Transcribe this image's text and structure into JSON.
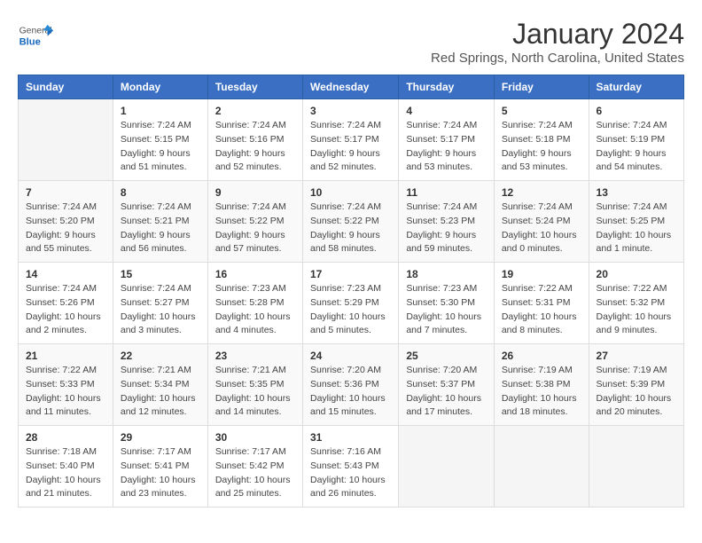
{
  "header": {
    "logo_general": "General",
    "logo_blue": "Blue",
    "main_title": "January 2024",
    "subtitle": "Red Springs, North Carolina, United States"
  },
  "days_of_week": [
    "Sunday",
    "Monday",
    "Tuesday",
    "Wednesday",
    "Thursday",
    "Friday",
    "Saturday"
  ],
  "weeks": [
    [
      {
        "day": "",
        "sunrise": "",
        "sunset": "",
        "daylight": ""
      },
      {
        "day": "1",
        "sunrise": "Sunrise: 7:24 AM",
        "sunset": "Sunset: 5:15 PM",
        "daylight": "Daylight: 9 hours and 51 minutes."
      },
      {
        "day": "2",
        "sunrise": "Sunrise: 7:24 AM",
        "sunset": "Sunset: 5:16 PM",
        "daylight": "Daylight: 9 hours and 52 minutes."
      },
      {
        "day": "3",
        "sunrise": "Sunrise: 7:24 AM",
        "sunset": "Sunset: 5:17 PM",
        "daylight": "Daylight: 9 hours and 52 minutes."
      },
      {
        "day": "4",
        "sunrise": "Sunrise: 7:24 AM",
        "sunset": "Sunset: 5:17 PM",
        "daylight": "Daylight: 9 hours and 53 minutes."
      },
      {
        "day": "5",
        "sunrise": "Sunrise: 7:24 AM",
        "sunset": "Sunset: 5:18 PM",
        "daylight": "Daylight: 9 hours and 53 minutes."
      },
      {
        "day": "6",
        "sunrise": "Sunrise: 7:24 AM",
        "sunset": "Sunset: 5:19 PM",
        "daylight": "Daylight: 9 hours and 54 minutes."
      }
    ],
    [
      {
        "day": "7",
        "sunrise": "Sunrise: 7:24 AM",
        "sunset": "Sunset: 5:20 PM",
        "daylight": "Daylight: 9 hours and 55 minutes."
      },
      {
        "day": "8",
        "sunrise": "Sunrise: 7:24 AM",
        "sunset": "Sunset: 5:21 PM",
        "daylight": "Daylight: 9 hours and 56 minutes."
      },
      {
        "day": "9",
        "sunrise": "Sunrise: 7:24 AM",
        "sunset": "Sunset: 5:22 PM",
        "daylight": "Daylight: 9 hours and 57 minutes."
      },
      {
        "day": "10",
        "sunrise": "Sunrise: 7:24 AM",
        "sunset": "Sunset: 5:22 PM",
        "daylight": "Daylight: 9 hours and 58 minutes."
      },
      {
        "day": "11",
        "sunrise": "Sunrise: 7:24 AM",
        "sunset": "Sunset: 5:23 PM",
        "daylight": "Daylight: 9 hours and 59 minutes."
      },
      {
        "day": "12",
        "sunrise": "Sunrise: 7:24 AM",
        "sunset": "Sunset: 5:24 PM",
        "daylight": "Daylight: 10 hours and 0 minutes."
      },
      {
        "day": "13",
        "sunrise": "Sunrise: 7:24 AM",
        "sunset": "Sunset: 5:25 PM",
        "daylight": "Daylight: 10 hours and 1 minute."
      }
    ],
    [
      {
        "day": "14",
        "sunrise": "Sunrise: 7:24 AM",
        "sunset": "Sunset: 5:26 PM",
        "daylight": "Daylight: 10 hours and 2 minutes."
      },
      {
        "day": "15",
        "sunrise": "Sunrise: 7:24 AM",
        "sunset": "Sunset: 5:27 PM",
        "daylight": "Daylight: 10 hours and 3 minutes."
      },
      {
        "day": "16",
        "sunrise": "Sunrise: 7:23 AM",
        "sunset": "Sunset: 5:28 PM",
        "daylight": "Daylight: 10 hours and 4 minutes."
      },
      {
        "day": "17",
        "sunrise": "Sunrise: 7:23 AM",
        "sunset": "Sunset: 5:29 PM",
        "daylight": "Daylight: 10 hours and 5 minutes."
      },
      {
        "day": "18",
        "sunrise": "Sunrise: 7:23 AM",
        "sunset": "Sunset: 5:30 PM",
        "daylight": "Daylight: 10 hours and 7 minutes."
      },
      {
        "day": "19",
        "sunrise": "Sunrise: 7:22 AM",
        "sunset": "Sunset: 5:31 PM",
        "daylight": "Daylight: 10 hours and 8 minutes."
      },
      {
        "day": "20",
        "sunrise": "Sunrise: 7:22 AM",
        "sunset": "Sunset: 5:32 PM",
        "daylight": "Daylight: 10 hours and 9 minutes."
      }
    ],
    [
      {
        "day": "21",
        "sunrise": "Sunrise: 7:22 AM",
        "sunset": "Sunset: 5:33 PM",
        "daylight": "Daylight: 10 hours and 11 minutes."
      },
      {
        "day": "22",
        "sunrise": "Sunrise: 7:21 AM",
        "sunset": "Sunset: 5:34 PM",
        "daylight": "Daylight: 10 hours and 12 minutes."
      },
      {
        "day": "23",
        "sunrise": "Sunrise: 7:21 AM",
        "sunset": "Sunset: 5:35 PM",
        "daylight": "Daylight: 10 hours and 14 minutes."
      },
      {
        "day": "24",
        "sunrise": "Sunrise: 7:20 AM",
        "sunset": "Sunset: 5:36 PM",
        "daylight": "Daylight: 10 hours and 15 minutes."
      },
      {
        "day": "25",
        "sunrise": "Sunrise: 7:20 AM",
        "sunset": "Sunset: 5:37 PM",
        "daylight": "Daylight: 10 hours and 17 minutes."
      },
      {
        "day": "26",
        "sunrise": "Sunrise: 7:19 AM",
        "sunset": "Sunset: 5:38 PM",
        "daylight": "Daylight: 10 hours and 18 minutes."
      },
      {
        "day": "27",
        "sunrise": "Sunrise: 7:19 AM",
        "sunset": "Sunset: 5:39 PM",
        "daylight": "Daylight: 10 hours and 20 minutes."
      }
    ],
    [
      {
        "day": "28",
        "sunrise": "Sunrise: 7:18 AM",
        "sunset": "Sunset: 5:40 PM",
        "daylight": "Daylight: 10 hours and 21 minutes."
      },
      {
        "day": "29",
        "sunrise": "Sunrise: 7:17 AM",
        "sunset": "Sunset: 5:41 PM",
        "daylight": "Daylight: 10 hours and 23 minutes."
      },
      {
        "day": "30",
        "sunrise": "Sunrise: 7:17 AM",
        "sunset": "Sunset: 5:42 PM",
        "daylight": "Daylight: 10 hours and 25 minutes."
      },
      {
        "day": "31",
        "sunrise": "Sunrise: 7:16 AM",
        "sunset": "Sunset: 5:43 PM",
        "daylight": "Daylight: 10 hours and 26 minutes."
      },
      {
        "day": "",
        "sunrise": "",
        "sunset": "",
        "daylight": ""
      },
      {
        "day": "",
        "sunrise": "",
        "sunset": "",
        "daylight": ""
      },
      {
        "day": "",
        "sunrise": "",
        "sunset": "",
        "daylight": ""
      }
    ]
  ]
}
